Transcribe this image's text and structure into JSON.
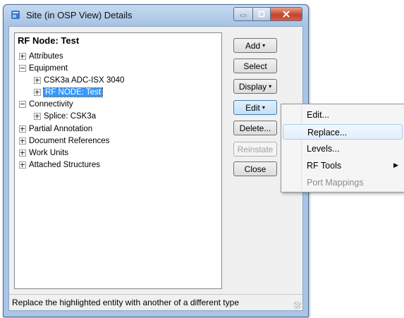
{
  "window": {
    "title": "Site (in OSP View) Details"
  },
  "tree": {
    "root": "RF Node: Test",
    "nodes": [
      {
        "label": "Attributes"
      },
      {
        "label": "Equipment"
      },
      {
        "label": "CSK3a ADC-ISX 3040"
      },
      {
        "label": "RF NODE: Test",
        "selected": true
      },
      {
        "label": "Connectivity"
      },
      {
        "label": "Splice: CSK3a"
      },
      {
        "label": "Partial Annotation"
      },
      {
        "label": "Document References"
      },
      {
        "label": "Work Units"
      },
      {
        "label": "Attached Structures"
      }
    ]
  },
  "buttons": {
    "add": "Add",
    "select": "Select",
    "display": "Display",
    "edit": "Edit",
    "delete": "Delete...",
    "reinstate": "Reinstate",
    "close": "Close"
  },
  "context_menu": {
    "items": [
      {
        "label": "Edit..."
      },
      {
        "label": "Replace...",
        "highlighted": true
      },
      {
        "label": "Levels..."
      },
      {
        "label": "RF Tools",
        "submenu": true
      },
      {
        "label": "Port Mappings",
        "disabled": true
      }
    ]
  },
  "status": {
    "text": "Replace the highlighted entity with another of a different type"
  }
}
